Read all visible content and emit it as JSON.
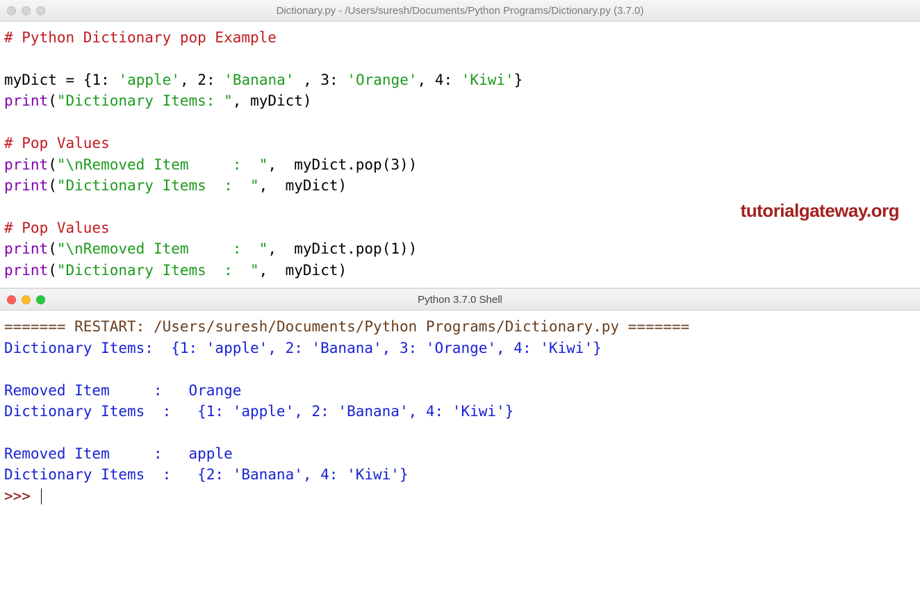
{
  "editor": {
    "title": "Dictionary.py - /Users/suresh/Documents/Python Programs/Dictionary.py (3.7.0)",
    "code": {
      "c1": "# Python Dictionary pop Example",
      "assign_lhs": "myDict ",
      "eq": "=",
      "sp": " ",
      "lb": "{",
      "k1": "1",
      "colon": ":",
      "s1": "'apple'",
      "comma": ",",
      "k2": "2",
      "s2": "'Banana'",
      "k3": "3",
      "s3": "'Orange'",
      "k4": "4",
      "s4": "'Kiwi'",
      "rb": "}",
      "print": "print",
      "lp": "(",
      "rp": ")",
      "str_items": "\"Dictionary Items: \"",
      "mydict": "myDict",
      "c2": "# Pop Values",
      "str_removed": "\"\\nRemoved Item     :  \"",
      "str_items2": "\"Dictionary Items  :  \"",
      "dot_pop": ".pop",
      "arg3": "3",
      "arg1": "1"
    }
  },
  "watermark": "tutorialgateway.org",
  "shell": {
    "title": "Python 3.7.0 Shell",
    "restart_pre": "=======",
    "restart_txt": " RESTART: /Users/suresh/Documents/Python Programs/Dictionary.py ",
    "restart_post": "=======",
    "line1": "Dictionary Items:  {1: 'apple', 2: 'Banana', 3: 'Orange', 4: 'Kiwi'}",
    "blank": "",
    "line2": "Removed Item     :   Orange",
    "line3": "Dictionary Items  :   {1: 'apple', 2: 'Banana', 4: 'Kiwi'}",
    "line4": "Removed Item     :   apple",
    "line5": "Dictionary Items  :   {2: 'Banana', 4: 'Kiwi'}",
    "prompt": ">>> "
  }
}
